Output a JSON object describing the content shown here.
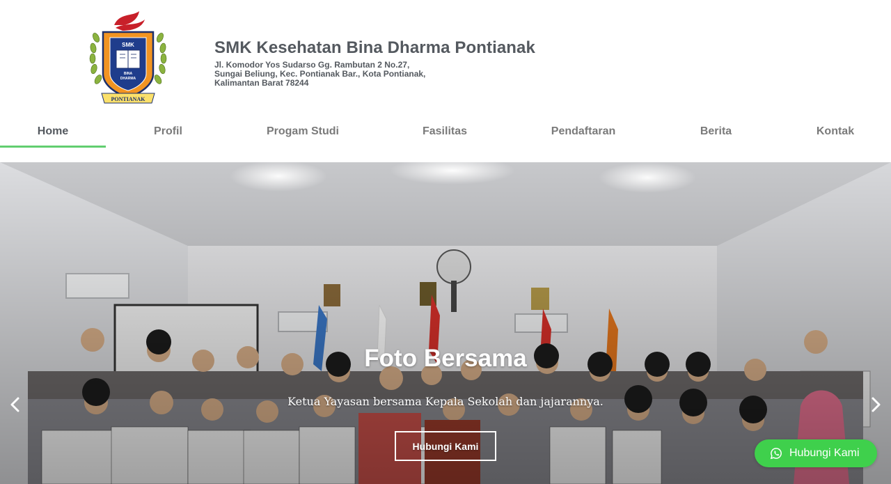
{
  "site": {
    "name": "SMK Kesehatan Bina Dharma Pontianak",
    "address_lines": [
      "Jl. Komodor Yos Sudarso Gg. Rambutan 2 No.27,",
      "Sungai Beliung, Kec. Pontianak Bar., Kota Pontianak,",
      "Kalimantan Barat 78244"
    ],
    "logo": {
      "top_text": "SMK",
      "mid_text_1": "BINA",
      "mid_text_2": "DHARMA",
      "ribbon_text": "PONTIANAK"
    }
  },
  "nav": {
    "items": [
      {
        "label": "Home",
        "active": true
      },
      {
        "label": "Profil",
        "active": false
      },
      {
        "label": "Progam Studi",
        "active": false
      },
      {
        "label": "Fasilitas",
        "active": false
      },
      {
        "label": "Pendaftaran",
        "active": false
      },
      {
        "label": "Berita",
        "active": false
      },
      {
        "label": "Kontak",
        "active": false
      }
    ],
    "active_color": "#61ce70"
  },
  "slider": {
    "title": "Foto Bersama",
    "description": "Ketua Yayasan bersama Kepala Sekolah dan jajarannya.",
    "button_label": "Hubungi Kami",
    "prev_icon": "chevron-left-icon",
    "next_icon": "chevron-right-icon"
  },
  "whatsapp": {
    "label": "Hubungi Kami",
    "icon": "whatsapp-icon",
    "color": "#3fd04c"
  }
}
